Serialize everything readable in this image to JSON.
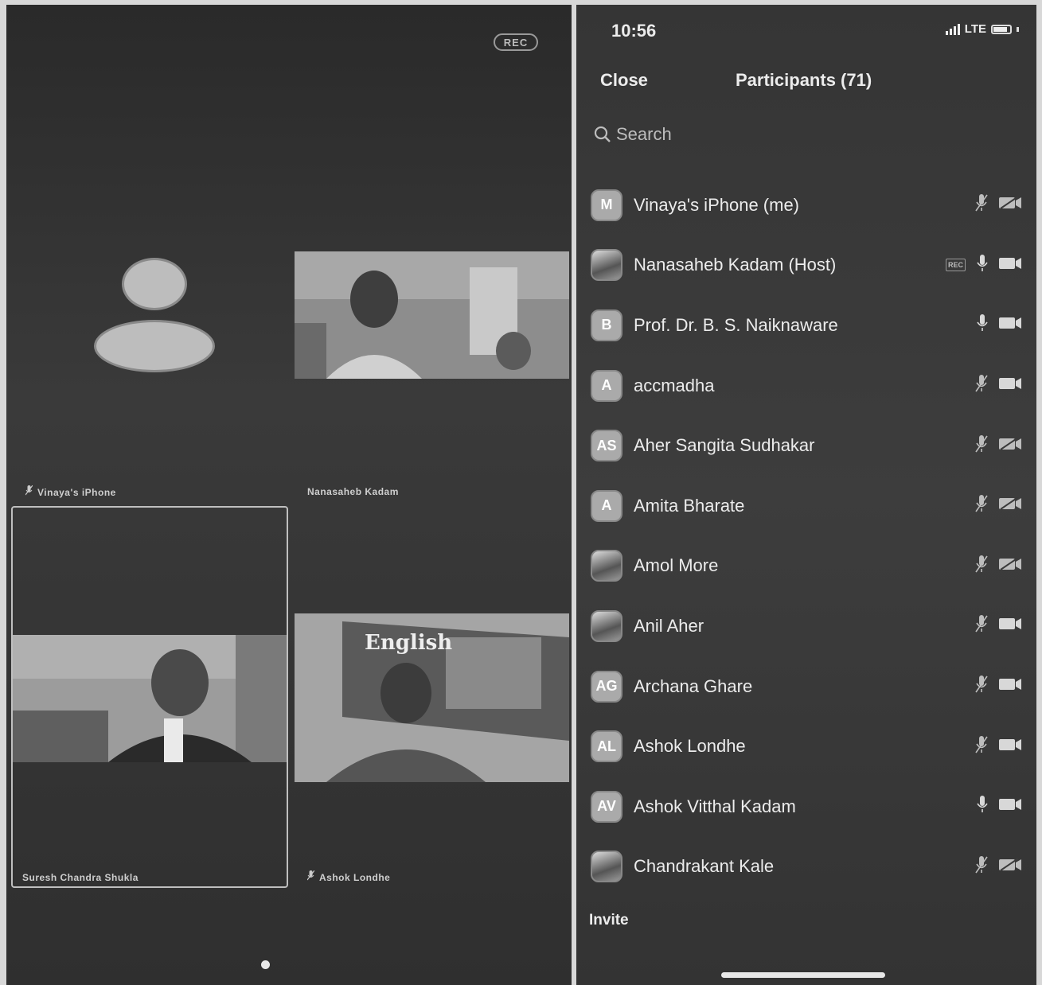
{
  "gallery": {
    "rec_badge": "REC",
    "tiles": [
      {
        "name": "Vinaya's iPhone",
        "type": "avatar",
        "muted": true
      },
      {
        "name": "Nanasaheb Kadam",
        "type": "video",
        "muted": false
      },
      {
        "name": "Suresh Chandra Shukla",
        "type": "video",
        "muted": false,
        "active_speaker": true
      },
      {
        "name": "Ashok Londhe",
        "type": "video",
        "muted": true
      }
    ],
    "video_overlay_text": "English",
    "page_indicator": {
      "pages": 1,
      "current": 1
    }
  },
  "status_bar": {
    "time": "10:56",
    "network": "LTE"
  },
  "participants_panel": {
    "close_label": "Close",
    "title": "Participants (71)",
    "search_placeholder": "Search",
    "invite_label": "Invite",
    "list": [
      {
        "initials": "M",
        "name": "Vinaya's iPhone (me)",
        "avatar": "initials",
        "mic": "muted",
        "video": "off",
        "rec": false
      },
      {
        "initials": "",
        "name": "Nanasaheb Kadam (Host)",
        "avatar": "photo",
        "mic": "on",
        "video": "on",
        "rec": true
      },
      {
        "initials": "B",
        "name": "Prof. Dr. B. S. Naiknaware",
        "avatar": "initials",
        "mic": "on",
        "video": "on",
        "rec": false
      },
      {
        "initials": "A",
        "name": "accmadha",
        "avatar": "initials",
        "mic": "muted",
        "video": "on",
        "rec": false
      },
      {
        "initials": "AS",
        "name": "Aher Sangita Sudhakar",
        "avatar": "initials",
        "mic": "muted",
        "video": "off",
        "rec": false
      },
      {
        "initials": "A",
        "name": "Amita Bharate",
        "avatar": "initials",
        "mic": "muted",
        "video": "off",
        "rec": false
      },
      {
        "initials": "",
        "name": "Amol More",
        "avatar": "photo",
        "mic": "muted",
        "video": "off",
        "rec": false
      },
      {
        "initials": "",
        "name": "Anil Aher",
        "avatar": "photo",
        "mic": "muted",
        "video": "on",
        "rec": false
      },
      {
        "initials": "AG",
        "name": "Archana Ghare",
        "avatar": "initials",
        "mic": "muted",
        "video": "on",
        "rec": false
      },
      {
        "initials": "AL",
        "name": "Ashok Londhe",
        "avatar": "initials",
        "mic": "muted",
        "video": "on",
        "rec": false
      },
      {
        "initials": "AV",
        "name": "Ashok Vitthal Kadam",
        "avatar": "initials",
        "mic": "on",
        "video": "on",
        "rec": false
      },
      {
        "initials": "",
        "name": "Chandrakant Kale",
        "avatar": "photo",
        "mic": "muted",
        "video": "off",
        "rec": false
      }
    ]
  },
  "icons": {
    "search": "search-icon",
    "mic": "microphone-icon",
    "mic_muted": "microphone-muted-icon",
    "video": "video-camera-icon",
    "video_off": "video-camera-off-icon",
    "signal": "cellular-signal-icon",
    "battery": "battery-icon"
  }
}
